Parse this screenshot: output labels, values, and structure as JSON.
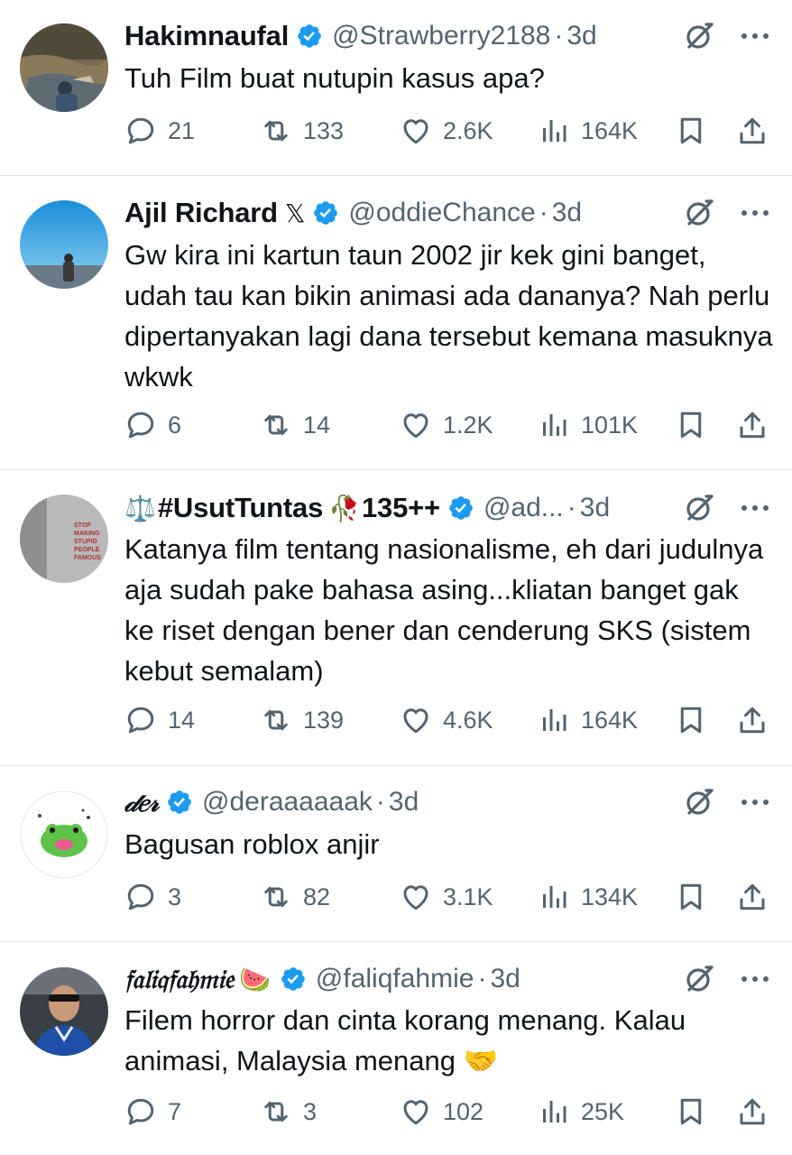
{
  "tweets": [
    {
      "name": "Hakimnaufal",
      "handle": "@Strawberry2188",
      "dot": "·",
      "time": "3d",
      "text": "Tuh Film buat nutupin kasus apa?",
      "replies": "21",
      "reposts": "133",
      "likes": "2.6K",
      "views": "164K"
    },
    {
      "name": "Ajil Richard",
      "name_suffix": "𝕏",
      "handle": "@oddieChance",
      "dot": "·",
      "time": "3d",
      "text": "Gw kira ini kartun taun 2002 jir kek gini banget, udah tau kan bikin animasi ada dananya? Nah perlu dipertanyakan lagi dana tersebut kemana masuknya wkwk",
      "replies": "6",
      "reposts": "14",
      "likes": "1.2K",
      "views": "101K"
    },
    {
      "name_prefix": "⚖️",
      "name": "#UsutTuntas",
      "name_emoji": "🥀",
      "name_suffix": "135++",
      "handle": "@ad...",
      "dot": "·",
      "time": "3d",
      "text": "Katanya film tentang nasionalisme, eh dari judulnya aja sudah pake bahasa asing...kliatan banget gak ke riset dengan bener dan cenderung SKS (sistem kebut semalam)",
      "avatar_text": "STOP MAKING STUPID PEOPLE FAMOUS",
      "replies": "14",
      "reposts": "139",
      "likes": "4.6K",
      "views": "164K"
    },
    {
      "name": "𝒹𝑒𝓇",
      "handle": "@deraaaaaak",
      "dot": "·",
      "time": "3d",
      "text": "Bagusan roblox anjir",
      "replies": "3",
      "reposts": "82",
      "likes": "3.1K",
      "views": "134K"
    },
    {
      "name": "𝔣𝔞𝔩𝔦𝔮𝔣𝔞𝔥𝔪𝔦𝔢",
      "name_emoji": "🍉",
      "handle": "@faliqfahmie",
      "dot": "·",
      "time": "3d",
      "text": "Filem horror dan cinta korang menang. Kalau animasi, Malaysia menang 🤝",
      "replies": "7",
      "reposts": "3",
      "likes": "102",
      "views": "25K"
    }
  ],
  "icons": {
    "verified": "verified-badge-icon",
    "grok": "grok-icon",
    "more": "more-icon",
    "reply": "reply-icon",
    "repost": "repost-icon",
    "like": "like-icon",
    "views": "views-icon",
    "bookmark": "bookmark-icon",
    "share": "share-icon"
  },
  "colors": {
    "verified_blue": "#1d9bf0",
    "text_primary": "#0f1419",
    "text_secondary": "#536471",
    "divider": "#e1e6ea"
  }
}
